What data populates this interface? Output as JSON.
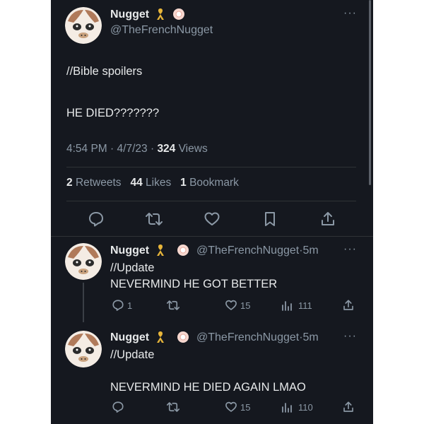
{
  "main_tweet": {
    "author_name": "Nugget",
    "handle": "@TheFrenchNugget",
    "line1": "//Bible spoilers",
    "line2": "HE DIED???????",
    "time": "4:54 PM",
    "date": "4/7/23",
    "views_count": "324",
    "views_label": "Views",
    "retweets_count": "2",
    "retweets_label": "Retweets",
    "likes_count": "44",
    "likes_label": "Likes",
    "bookmarks_count": "1",
    "bookmarks_label": "Bookmark"
  },
  "replies": [
    {
      "author_name": "Nugget",
      "handle": "@TheFrenchNugget",
      "age": "5m",
      "line1": "//Update",
      "line2": "NEVERMIND HE GOT BETTER",
      "reply_count": "1",
      "like_count": "15",
      "views_count": "111"
    },
    {
      "author_name": "Nugget",
      "handle": "@TheFrenchNugget",
      "age": "5m",
      "line1": "//Update",
      "line2": "NEVERMIND HE DIED AGAIN LMAO",
      "like_count": "15",
      "views_count": "110"
    }
  ],
  "separator_dot": "·",
  "colors": {
    "background": "#15181f",
    "text": "#e7e9ea",
    "muted": "#8b98a5",
    "ribbon": "#e7b53a"
  },
  "icons": [
    "reply-icon",
    "retweet-icon",
    "like-icon",
    "bookmark-icon",
    "share-icon",
    "views-icon",
    "ribbon-icon",
    "flower-badge-icon",
    "more-icon"
  ]
}
